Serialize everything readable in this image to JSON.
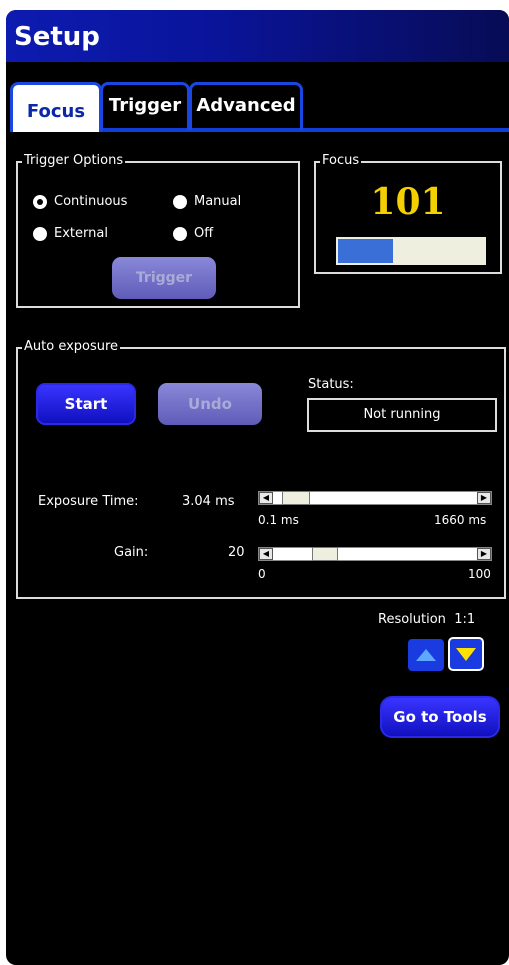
{
  "window": {
    "title": "Setup"
  },
  "tabs": [
    {
      "label": "Focus",
      "active": true
    },
    {
      "label": "Trigger",
      "active": false
    },
    {
      "label": "Advanced",
      "active": false
    }
  ],
  "trigger_options": {
    "legend": "Trigger Options",
    "options": [
      {
        "label": "Continuous",
        "selected": true
      },
      {
        "label": "Manual",
        "selected": false
      },
      {
        "label": "External",
        "selected": false
      },
      {
        "label": "Off",
        "selected": false
      }
    ],
    "trigger_button": "Trigger"
  },
  "focus": {
    "legend": "Focus",
    "value": "101",
    "bar_fraction": 0.38,
    "bar_color": "#3a6fd8"
  },
  "auto_exposure": {
    "legend": "Auto exposure",
    "start_button": "Start",
    "undo_button": "Undo",
    "status_label": "Status:",
    "status_value": "Not running",
    "exposure": {
      "label": "Exposure Time:",
      "value": "3.04 ms",
      "min": "0.1 ms",
      "max": "1660 ms",
      "level": 0.05
    },
    "gain": {
      "label": "Gain:",
      "value": "20",
      "min": "0",
      "max": "100",
      "level": 0.22
    }
  },
  "resolution": {
    "label": "Resolution",
    "value": "1:1"
  },
  "go_to_tools": "Go to Tools",
  "colors": {
    "accent": "#1b46e0",
    "background": "#000000",
    "title_gradient_start": "#0d1bb0"
  }
}
